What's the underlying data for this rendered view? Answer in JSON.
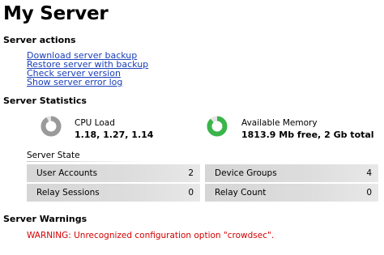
{
  "page": {
    "title": "My Server"
  },
  "actions": {
    "heading": "Server actions",
    "links": [
      "Download server backup",
      "Restore server with backup",
      "Check server version",
      "Show server error log"
    ]
  },
  "statistics": {
    "heading": "Server Statistics",
    "cpu": {
      "label": "CPU Load",
      "value": "1.18, 1.27, 1.14",
      "gauge_color": "#9a9a9a",
      "gauge_fraction": 0.92
    },
    "memory": {
      "label": "Available Memory",
      "free": "1813.9 Mb free,",
      "total": "2 Gb total",
      "gauge_color": "#3bb54a",
      "gauge_fraction": 0.88
    }
  },
  "server_state": {
    "title": "Server State",
    "rows": [
      {
        "name": "User Accounts",
        "count": "2"
      },
      {
        "name": "Device Groups",
        "count": "4"
      },
      {
        "name": "Relay Sessions",
        "count": "0"
      },
      {
        "name": "Relay Count",
        "count": "0"
      }
    ]
  },
  "warnings": {
    "heading": "Server Warnings",
    "message": "WARNING: Unrecognized configuration option \"crowdsec\".",
    "color": "#d40000"
  }
}
